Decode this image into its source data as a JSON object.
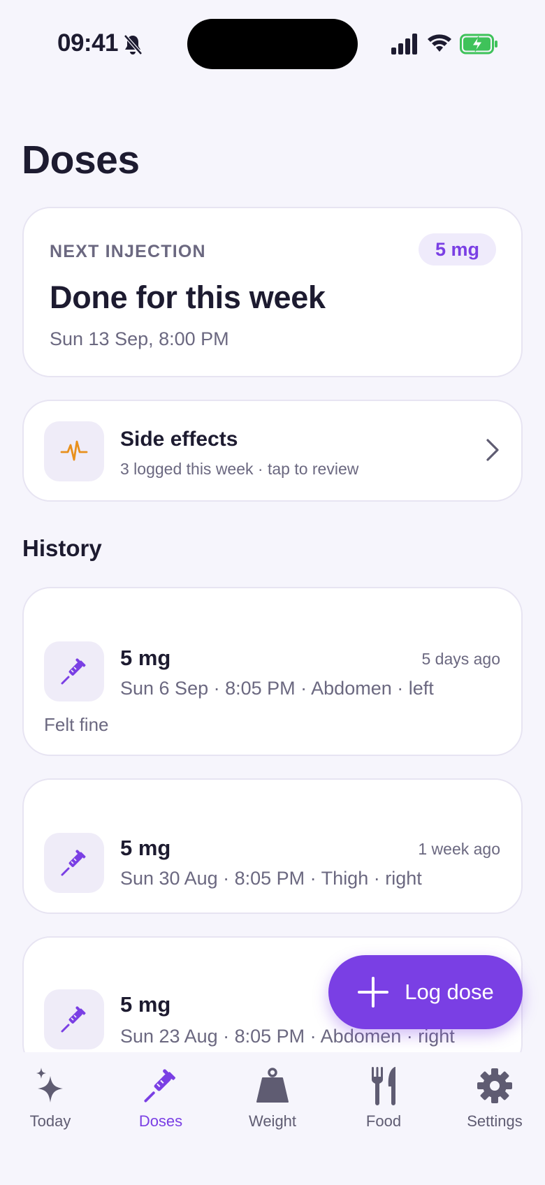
{
  "status_bar": {
    "time": "09:41"
  },
  "header": {
    "title": "Doses"
  },
  "next_injection": {
    "label": "NEXT INJECTION",
    "dose": "5 mg",
    "title": "Done for this week",
    "date": "Sun 13 Sep, 8:00 PM"
  },
  "side_effects": {
    "title": "Side effects",
    "subtitle": "3 logged this week · tap to review",
    "icon": "heartbeat-icon"
  },
  "history": {
    "title": "History",
    "items": [
      {
        "dose": "5 mg",
        "ago": "5 days ago",
        "meta": "Sun 6 Sep · 8:05 PM · Abdomen · left",
        "note": "Felt fine"
      },
      {
        "dose": "5 mg",
        "ago": "1 week ago",
        "meta": "Sun 30 Aug · 8:05 PM · Thigh · right"
      },
      {
        "dose": "5 mg",
        "ago": "",
        "meta": "Sun 23 Aug · 8:05 PM · Abdomen · right"
      }
    ]
  },
  "fab": {
    "label": "Log dose"
  },
  "tabs": [
    {
      "label": "Today",
      "icon": "sparkle-icon"
    },
    {
      "label": "Doses",
      "icon": "syringe-icon",
      "active": true
    },
    {
      "label": "Weight",
      "icon": "weight-icon"
    },
    {
      "label": "Food",
      "icon": "fork-knife-icon"
    },
    {
      "label": "Settings",
      "icon": "gear-icon"
    }
  ],
  "colors": {
    "accent": "#7a3fe4",
    "warning": "#e8901c",
    "background": "#f6f5fc"
  }
}
